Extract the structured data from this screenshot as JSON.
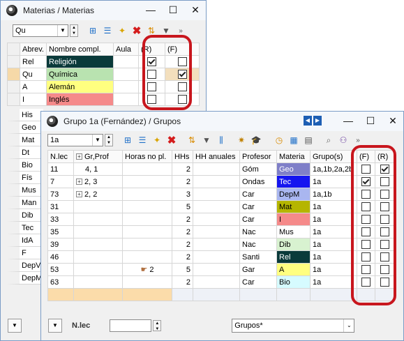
{
  "back_window": {
    "title": "Materias / Materias",
    "selector_value": "Qu",
    "columns": [
      "Abrev.",
      "Nombre compl.",
      "Aula",
      "(R)",
      "(F)"
    ],
    "rows": [
      {
        "abrev": "Rel",
        "nombre": "Religión",
        "color": "#0a3a3a",
        "text_color": "#ffffff",
        "r": true,
        "f": false,
        "f_bg": "#ffffff"
      },
      {
        "abrev": "Qu",
        "nombre": "Química",
        "color": "#b9e3b0",
        "text_color": "#000000",
        "r": false,
        "f": true,
        "f_bg": "#f3dfbd"
      },
      {
        "abrev": "A",
        "nombre": "Alemán",
        "color": "#ffff80",
        "text_color": "#000000",
        "r": false,
        "f": false,
        "f_bg": "#ffffff"
      },
      {
        "abrev": "I",
        "nombre": "Inglés",
        "color": "#f58a8a",
        "text_color": "#000000",
        "r": false,
        "f": false,
        "f_bg": "#ffffff"
      }
    ],
    "abrev_list": [
      "His",
      "Geo",
      "Mat",
      "Dt",
      "Bio",
      "Fís",
      "Mus",
      "Man",
      "Dib",
      "Tec",
      "IdA",
      "F",
      "DepV",
      "DepM"
    ]
  },
  "front_window": {
    "title": "Grupo 1a (Fernández) / Grupos",
    "selector_value": "1a",
    "columns": [
      "N.lec",
      "Gr,Prof",
      "Horas no pl.",
      "HHs",
      "HH anuales",
      "Profesor",
      "Materia",
      "Grupo(s)",
      "(F)",
      "(R)"
    ],
    "rows": [
      {
        "nlec": "11",
        "grprof": "4, 1",
        "expand": false,
        "horas": "",
        "hhs": "2",
        "profesor": "Góm",
        "materia": "Geo",
        "mat_bg": "#7f7fc8",
        "mat_fg": "#ffffff",
        "grupos": "1a,1b,2a,2b",
        "f": false,
        "r": true
      },
      {
        "nlec": "7",
        "grprof": "2, 3",
        "expand": true,
        "horas": "",
        "hhs": "2",
        "profesor": "Ondas",
        "materia": "Tec",
        "mat_bg": "#1515f0",
        "mat_fg": "#ffffff",
        "grupos": "1a",
        "f": true,
        "r": false
      },
      {
        "nlec": "73",
        "grprof": "2, 2",
        "expand": true,
        "horas": "",
        "hhs": "3",
        "profesor": "Car",
        "materia": "DepM",
        "mat_bg": "#a9b6f0",
        "mat_fg": "#000000",
        "grupos": "1a,1b",
        "f": false,
        "r": false
      },
      {
        "nlec": "31",
        "grprof": "",
        "expand": false,
        "horas": "",
        "hhs": "5",
        "profesor": "Car",
        "materia": "Mat",
        "mat_bg": "#b5b500",
        "mat_fg": "#000000",
        "grupos": "1a",
        "f": false,
        "r": false
      },
      {
        "nlec": "33",
        "grprof": "",
        "expand": false,
        "horas": "",
        "hhs": "2",
        "profesor": "Car",
        "materia": "I",
        "mat_bg": "#f58a8a",
        "mat_fg": "#000000",
        "grupos": "1a",
        "f": false,
        "r": false
      },
      {
        "nlec": "35",
        "grprof": "",
        "expand": false,
        "horas": "",
        "hhs": "2",
        "profesor": "Nac",
        "materia": "Mus",
        "mat_bg": "#ffffff",
        "mat_fg": "#000000",
        "grupos": "1a",
        "f": false,
        "r": false
      },
      {
        "nlec": "39",
        "grprof": "",
        "expand": false,
        "horas": "",
        "hhs": "2",
        "profesor": "Nac",
        "materia": "Dib",
        "mat_bg": "#d8f2d0",
        "mat_fg": "#000000",
        "grupos": "1a",
        "f": false,
        "r": false
      },
      {
        "nlec": "46",
        "grprof": "",
        "expand": false,
        "horas": "",
        "hhs": "2",
        "profesor": "Santi",
        "materia": "Rel",
        "mat_bg": "#0a3a3a",
        "mat_fg": "#ffffff",
        "grupos": "1a",
        "f": false,
        "r": false
      },
      {
        "nlec": "53",
        "grprof": "",
        "expand": false,
        "horas": "2",
        "hhs": "5",
        "profesor": "Gar",
        "materia": "A",
        "mat_bg": "#ffff80",
        "mat_fg": "#000000",
        "grupos": "1a",
        "f": false,
        "r": false
      },
      {
        "nlec": "63",
        "grprof": "",
        "expand": false,
        "horas": "",
        "hhs": "2",
        "profesor": "Car",
        "materia": "Bio",
        "mat_bg": "#d6fbff",
        "mat_fg": "#000000",
        "grupos": "1a",
        "f": false,
        "r": false
      }
    ],
    "footer_label": "N.lec",
    "view_select": "Grupos*"
  },
  "window_buttons": {
    "minimize": "—",
    "maximize": "☐",
    "close": "✕"
  }
}
